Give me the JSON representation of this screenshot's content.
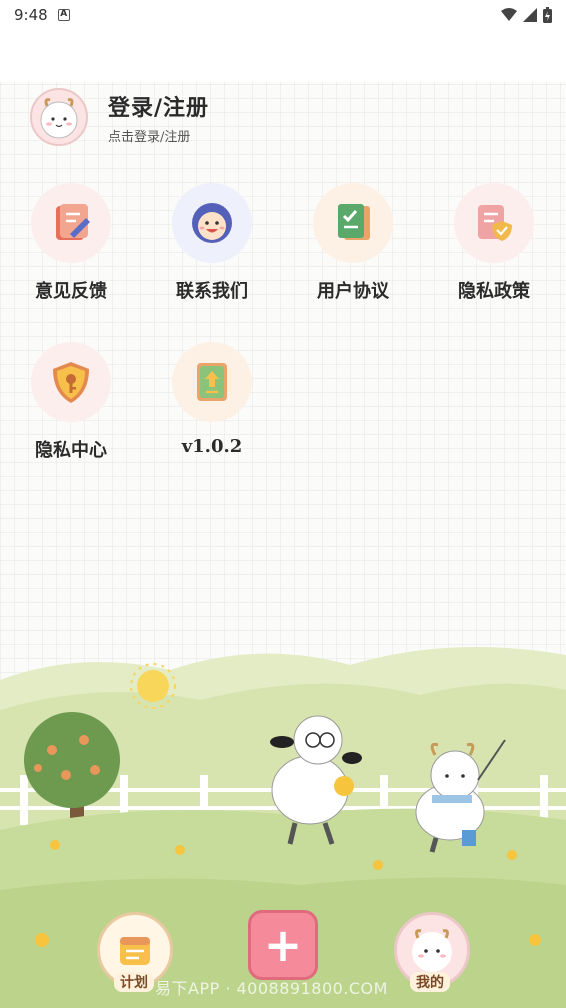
{
  "status_bar": {
    "time": "9:48",
    "notification_icon": "a-icon"
  },
  "profile": {
    "title": "登录/注册",
    "subtitle": "点击登录/注册"
  },
  "menu_items": [
    {
      "label": "意见反馈",
      "icon": "feedback-icon"
    },
    {
      "label": "联系我们",
      "icon": "contact-icon"
    },
    {
      "label": "用户协议",
      "icon": "agreement-icon"
    },
    {
      "label": "隐私政策",
      "icon": "privacy-policy-icon"
    },
    {
      "label": "隐私中心",
      "icon": "privacy-center-icon"
    },
    {
      "label": "v1.0.2",
      "icon": "version-icon"
    }
  ],
  "bottom_nav": {
    "plan_label": "计划",
    "add_label": "+",
    "mine_label": "我的"
  },
  "watermark": "易下APP · 4008891800.COM",
  "colors": {
    "accent_pink": "#f48a9a",
    "grass": "#c7dc9a",
    "icon_bg": "#fdeeee"
  }
}
